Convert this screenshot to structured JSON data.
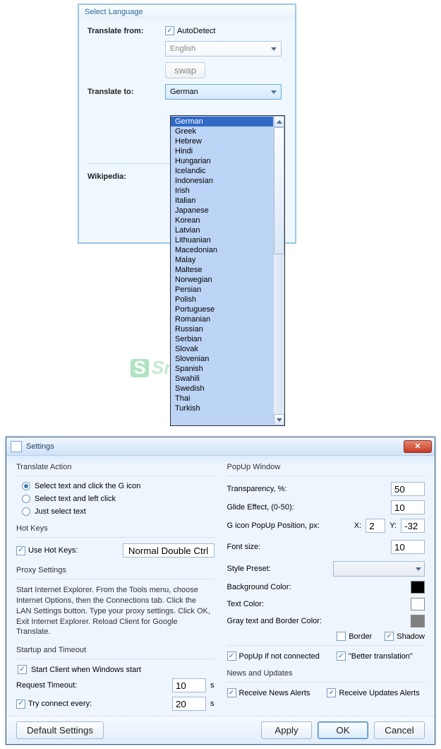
{
  "watermark_text": "SnapFiles",
  "lang_panel": {
    "title": "Select Language",
    "from_label": "Translate from:",
    "autodetect_checked": true,
    "autodetect_label": "AutoDetect",
    "from_combo": "English",
    "swap_btn": "swap",
    "to_label": "Translate to:",
    "to_combo": "German",
    "wikipedia_label": "Wikipedia:"
  },
  "dropdown": {
    "selected": "German",
    "items": [
      "German",
      "Greek",
      "Hebrew",
      "Hindi",
      "Hungarian",
      "Icelandic",
      "Indonesian",
      "Irish",
      "Italian",
      "Japanese",
      "Korean",
      "Latvian",
      "Lithuanian",
      "Macedonian",
      "Malay",
      "Maltese",
      "Norwegian",
      "Persian",
      "Polish",
      "Portuguese",
      "Romanian",
      "Russian",
      "Serbian",
      "Slovak",
      "Slovenian",
      "Spanish",
      "Swahili",
      "Swedish",
      "Thai",
      "Turkish"
    ]
  },
  "settings": {
    "title": "Settings",
    "translate_action": {
      "title": "Translate Action",
      "opt1": "Select text and click the G icon",
      "opt2": "Select text and left click",
      "opt3": "Just select text",
      "selected": 0
    },
    "hotkeys": {
      "title": "Hot Keys",
      "use_label": "Use Hot Keys:",
      "use_checked": true,
      "value": "Normal Double Ctrl"
    },
    "proxy": {
      "title": "Proxy Settings",
      "text": "Start Internet Explorer. From the Tools menu, choose Internet Options, then the Connections tab. Click the LAN Settings button. Type your proxy settings. Click OK, Exit Internet Explorer. Reload Client for Google Translate."
    },
    "startup": {
      "title": "Startup and Timeout",
      "start_label": "Start Client when Windows start",
      "start_checked": true,
      "timeout_label": "Request Timeout:",
      "timeout_value": "10",
      "seconds": "s",
      "connect_label": "Try connect every:",
      "connect_checked": true,
      "connect_value": "20"
    },
    "popup": {
      "title": "PopUp Window",
      "transparency_label": "Transparency, %:",
      "transparency_value": "50",
      "glide_label": "Glide Effect, (0-50):",
      "glide_value": "10",
      "gicon_label": "G icon PopUp Position, px:",
      "x_label": "X:",
      "x_value": "2",
      "y_label": "Y:",
      "y_value": "-32",
      "font_label": "Font size:",
      "font_value": "10",
      "preset_label": "Style Preset:",
      "bg_label": "Background Color:",
      "bg_color": "#000000",
      "text_label": "Text Color:",
      "text_color": "#ffffff",
      "gray_label": "Gray text and Border Color:",
      "gray_color": "#808080",
      "border_label": "Border",
      "border_checked": false,
      "shadow_label": "Shadow",
      "shadow_checked": true,
      "popup_if_label": "PopUp if not connected",
      "popup_if_checked": true,
      "better_label": "\"Better translation\"",
      "better_checked": true
    },
    "news": {
      "title": "News and Updates",
      "news_label": "Receive News Alerts",
      "news_checked": true,
      "updates_label": "Receive Updates Alerts",
      "updates_checked": true
    },
    "buttons": {
      "default": "Default Settings",
      "apply": "Apply",
      "ok": "OK",
      "cancel": "Cancel"
    }
  }
}
